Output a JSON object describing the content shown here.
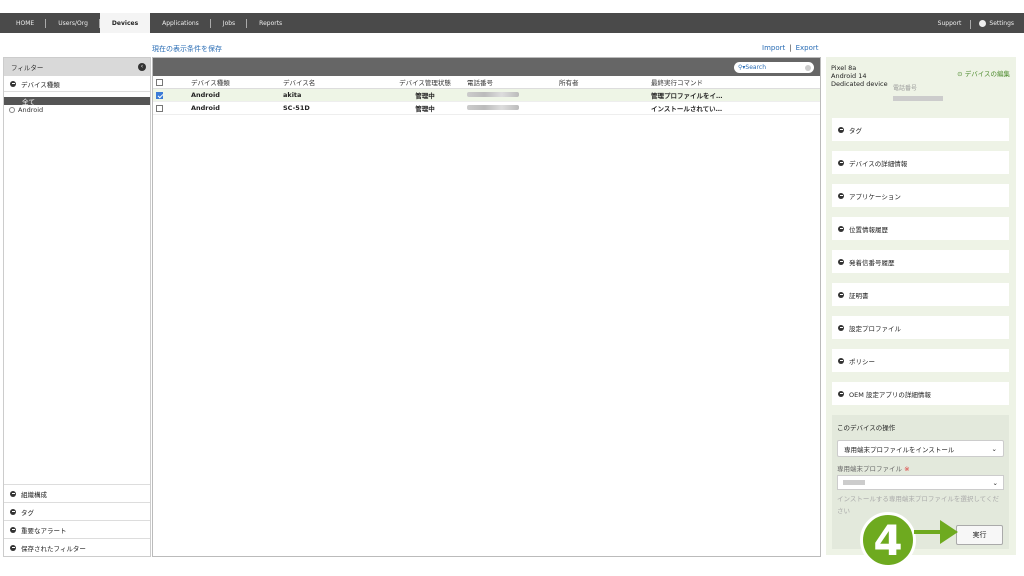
{
  "topnav": {
    "items": [
      "HOME",
      "Users/Org",
      "Devices",
      "Applications",
      "Jobs",
      "Reports"
    ],
    "active": "Devices",
    "support": "Support",
    "settings": "Settings"
  },
  "toolbar": {
    "save_view": "現在の表示条件を保存",
    "import": "Import",
    "separator": "|",
    "export": "Export"
  },
  "filter": {
    "title": "フィルター",
    "device_type_section": "デバイス種類",
    "all_label": "全て",
    "android_label": "Android",
    "bottom_sections": [
      "組織構成",
      "タグ",
      "重要なアラート",
      "保存されたフィルター"
    ]
  },
  "search": {
    "placeholder": "Search"
  },
  "table": {
    "headers": [
      "デバイス種類",
      "デバイス名",
      "デバイス管理状態",
      "電話番号",
      "所有者",
      "最終実行コマンド"
    ],
    "rows": [
      {
        "checked": true,
        "type": "Android",
        "name": "akita",
        "status": "管理中",
        "owner": "",
        "last_command": "管理プロファイルをイ…"
      },
      {
        "checked": false,
        "type": "Android",
        "name": "SC-51D",
        "status": "管理中",
        "owner": "",
        "last_command": "インストールされてい…"
      }
    ]
  },
  "device_panel": {
    "model": "Pixel 8a",
    "os": "Android 14",
    "mode": "Dedicated device",
    "edit_link": "デバイスの編集",
    "phone_label": "電話番号",
    "sections": [
      "タグ",
      "デバイスの詳細情報",
      "アプリケーション",
      "位置情報履歴",
      "発着信番号履歴",
      "証明書",
      "設定プロファイル",
      "ポリシー",
      "OEM 設定アプリの詳細情報"
    ]
  },
  "operations": {
    "title": "このデバイスの操作",
    "selected_action": "専用端末プロファイルをインストール",
    "profile_label": "専用端末プロファイル",
    "required_mark": "※",
    "hint": "インストールする専用端末プロファイルを選択してください",
    "run_button": "実行"
  },
  "annotation": {
    "step": "4"
  },
  "colors": {
    "accent_green": "#6eaa1f",
    "link_blue": "#2a6db5",
    "topbar": "#4a4a4a"
  }
}
